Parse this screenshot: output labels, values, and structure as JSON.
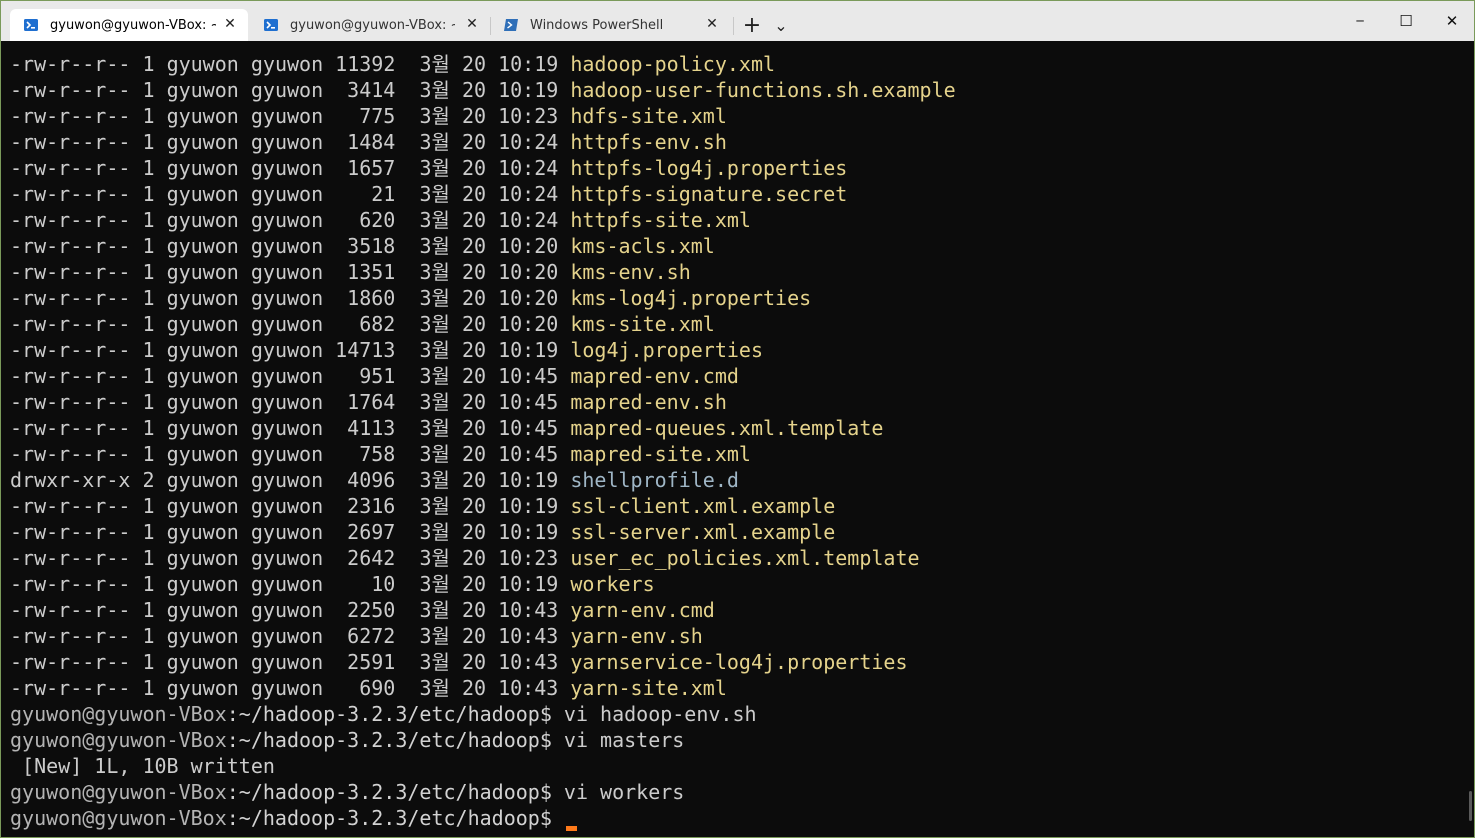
{
  "tabs": [
    {
      "label": "gyuwon@gyuwon-VBox: ~/h",
      "icon": "linux-terminal-icon",
      "active": true
    },
    {
      "label": "gyuwon@gyuwon-VBox: ~/ha",
      "icon": "linux-terminal-icon",
      "active": false
    },
    {
      "label": "Windows PowerShell",
      "icon": "powershell-icon",
      "active": false
    }
  ],
  "toolbar": {
    "new_tab": "+",
    "dropdown": "⌄"
  },
  "window_controls": {
    "minimize": "─",
    "maximize": "☐",
    "close": "✕"
  },
  "listing": [
    {
      "perm": "-rw-r--r--",
      "links": "1",
      "owner": "gyuwon",
      "group": "gyuwon",
      "size": "11392",
      "month": "3월",
      "day": "20",
      "time": "10:19",
      "name": "hadoop-policy.xml",
      "type": "file"
    },
    {
      "perm": "-rw-r--r--",
      "links": "1",
      "owner": "gyuwon",
      "group": "gyuwon",
      "size": "3414",
      "month": "3월",
      "day": "20",
      "time": "10:19",
      "name": "hadoop-user-functions.sh.example",
      "type": "file"
    },
    {
      "perm": "-rw-r--r--",
      "links": "1",
      "owner": "gyuwon",
      "group": "gyuwon",
      "size": "775",
      "month": "3월",
      "day": "20",
      "time": "10:23",
      "name": "hdfs-site.xml",
      "type": "file"
    },
    {
      "perm": "-rw-r--r--",
      "links": "1",
      "owner": "gyuwon",
      "group": "gyuwon",
      "size": "1484",
      "month": "3월",
      "day": "20",
      "time": "10:24",
      "name": "httpfs-env.sh",
      "type": "file"
    },
    {
      "perm": "-rw-r--r--",
      "links": "1",
      "owner": "gyuwon",
      "group": "gyuwon",
      "size": "1657",
      "month": "3월",
      "day": "20",
      "time": "10:24",
      "name": "httpfs-log4j.properties",
      "type": "file"
    },
    {
      "perm": "-rw-r--r--",
      "links": "1",
      "owner": "gyuwon",
      "group": "gyuwon",
      "size": "21",
      "month": "3월",
      "day": "20",
      "time": "10:24",
      "name": "httpfs-signature.secret",
      "type": "file"
    },
    {
      "perm": "-rw-r--r--",
      "links": "1",
      "owner": "gyuwon",
      "group": "gyuwon",
      "size": "620",
      "month": "3월",
      "day": "20",
      "time": "10:24",
      "name": "httpfs-site.xml",
      "type": "file"
    },
    {
      "perm": "-rw-r--r--",
      "links": "1",
      "owner": "gyuwon",
      "group": "gyuwon",
      "size": "3518",
      "month": "3월",
      "day": "20",
      "time": "10:20",
      "name": "kms-acls.xml",
      "type": "file"
    },
    {
      "perm": "-rw-r--r--",
      "links": "1",
      "owner": "gyuwon",
      "group": "gyuwon",
      "size": "1351",
      "month": "3월",
      "day": "20",
      "time": "10:20",
      "name": "kms-env.sh",
      "type": "file"
    },
    {
      "perm": "-rw-r--r--",
      "links": "1",
      "owner": "gyuwon",
      "group": "gyuwon",
      "size": "1860",
      "month": "3월",
      "day": "20",
      "time": "10:20",
      "name": "kms-log4j.properties",
      "type": "file"
    },
    {
      "perm": "-rw-r--r--",
      "links": "1",
      "owner": "gyuwon",
      "group": "gyuwon",
      "size": "682",
      "month": "3월",
      "day": "20",
      "time": "10:20",
      "name": "kms-site.xml",
      "type": "file"
    },
    {
      "perm": "-rw-r--r--",
      "links": "1",
      "owner": "gyuwon",
      "group": "gyuwon",
      "size": "14713",
      "month": "3월",
      "day": "20",
      "time": "10:19",
      "name": "log4j.properties",
      "type": "file"
    },
    {
      "perm": "-rw-r--r--",
      "links": "1",
      "owner": "gyuwon",
      "group": "gyuwon",
      "size": "951",
      "month": "3월",
      "day": "20",
      "time": "10:45",
      "name": "mapred-env.cmd",
      "type": "file"
    },
    {
      "perm": "-rw-r--r--",
      "links": "1",
      "owner": "gyuwon",
      "group": "gyuwon",
      "size": "1764",
      "month": "3월",
      "day": "20",
      "time": "10:45",
      "name": "mapred-env.sh",
      "type": "file"
    },
    {
      "perm": "-rw-r--r--",
      "links": "1",
      "owner": "gyuwon",
      "group": "gyuwon",
      "size": "4113",
      "month": "3월",
      "day": "20",
      "time": "10:45",
      "name": "mapred-queues.xml.template",
      "type": "file"
    },
    {
      "perm": "-rw-r--r--",
      "links": "1",
      "owner": "gyuwon",
      "group": "gyuwon",
      "size": "758",
      "month": "3월",
      "day": "20",
      "time": "10:45",
      "name": "mapred-site.xml",
      "type": "file"
    },
    {
      "perm": "drwxr-xr-x",
      "links": "2",
      "owner": "gyuwon",
      "group": "gyuwon",
      "size": "4096",
      "month": "3월",
      "day": "20",
      "time": "10:19",
      "name": "shellprofile.d",
      "type": "dir"
    },
    {
      "perm": "-rw-r--r--",
      "links": "1",
      "owner": "gyuwon",
      "group": "gyuwon",
      "size": "2316",
      "month": "3월",
      "day": "20",
      "time": "10:19",
      "name": "ssl-client.xml.example",
      "type": "file"
    },
    {
      "perm": "-rw-r--r--",
      "links": "1",
      "owner": "gyuwon",
      "group": "gyuwon",
      "size": "2697",
      "month": "3월",
      "day": "20",
      "time": "10:19",
      "name": "ssl-server.xml.example",
      "type": "file"
    },
    {
      "perm": "-rw-r--r--",
      "links": "1",
      "owner": "gyuwon",
      "group": "gyuwon",
      "size": "2642",
      "month": "3월",
      "day": "20",
      "time": "10:23",
      "name": "user_ec_policies.xml.template",
      "type": "file"
    },
    {
      "perm": "-rw-r--r--",
      "links": "1",
      "owner": "gyuwon",
      "group": "gyuwon",
      "size": "10",
      "month": "3월",
      "day": "20",
      "time": "10:19",
      "name": "workers",
      "type": "file"
    },
    {
      "perm": "-rw-r--r--",
      "links": "1",
      "owner": "gyuwon",
      "group": "gyuwon",
      "size": "2250",
      "month": "3월",
      "day": "20",
      "time": "10:43",
      "name": "yarn-env.cmd",
      "type": "file"
    },
    {
      "perm": "-rw-r--r--",
      "links": "1",
      "owner": "gyuwon",
      "group": "gyuwon",
      "size": "6272",
      "month": "3월",
      "day": "20",
      "time": "10:43",
      "name": "yarn-env.sh",
      "type": "file"
    },
    {
      "perm": "-rw-r--r--",
      "links": "1",
      "owner": "gyuwon",
      "group": "gyuwon",
      "size": "2591",
      "month": "3월",
      "day": "20",
      "time": "10:43",
      "name": "yarnservice-log4j.properties",
      "type": "file"
    },
    {
      "perm": "-rw-r--r--",
      "links": "1",
      "owner": "gyuwon",
      "group": "gyuwon",
      "size": "690",
      "month": "3월",
      "day": "20",
      "time": "10:43",
      "name": "yarn-site.xml",
      "type": "file"
    }
  ],
  "session": [
    {
      "kind": "prompt",
      "user": "gyuwon@gyuwon-VBox",
      "path": ":~/hadoop-3.2.3/etc/hadoop$",
      "command": " vi hadoop-env.sh"
    },
    {
      "kind": "prompt",
      "user": "gyuwon@gyuwon-VBox",
      "path": ":~/hadoop-3.2.3/etc/hadoop$",
      "command": " vi masters"
    },
    {
      "kind": "output",
      "text": " [New] 1L, 10B written"
    },
    {
      "kind": "prompt",
      "user": "gyuwon@gyuwon-VBox",
      "path": ":~/hadoop-3.2.3/etc/hadoop$",
      "command": " vi workers"
    },
    {
      "kind": "prompt",
      "user": "gyuwon@gyuwon-VBox",
      "path": ":~/hadoop-3.2.3/etc/hadoop$",
      "command": " "
    }
  ],
  "colors": {
    "file": "#e5d38c",
    "dir": "#9fb6c6",
    "cursor": "#ff7a1a",
    "background": "#0c0c0c"
  }
}
